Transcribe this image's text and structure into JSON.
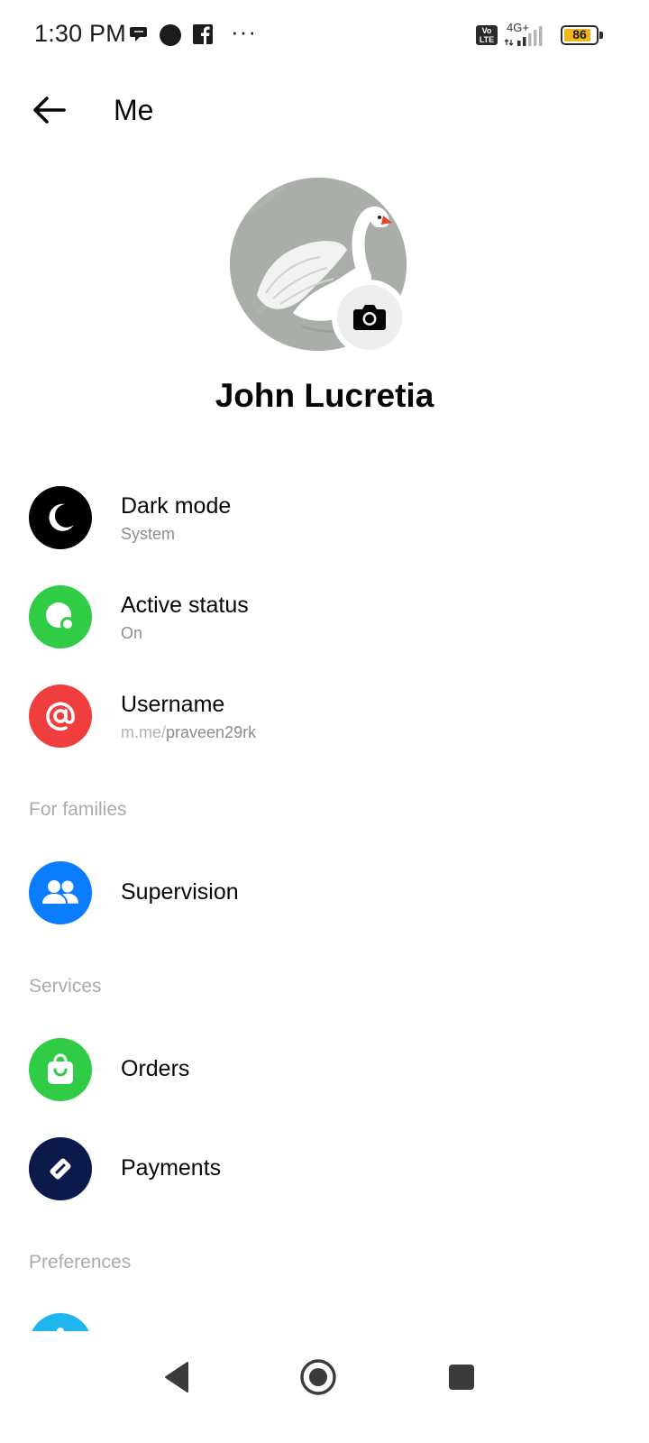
{
  "status_bar": {
    "time": "1:30 PM",
    "network_type": "4G+",
    "volte_label": "Vo LTE",
    "battery_percent": 86,
    "battery_label": "86",
    "more_indicator": "···",
    "notification_icons": [
      "chat-bubble-icon",
      "dot-icon",
      "facebook-icon"
    ]
  },
  "header": {
    "title": "Me"
  },
  "profile": {
    "name": "John Lucretia",
    "avatar_icon": "swan-photo",
    "camera_icon": "camera-icon"
  },
  "settings": {
    "dark_mode": {
      "title": "Dark mode",
      "subtitle": "System",
      "icon": "moon-icon",
      "color": "#000000"
    },
    "active_status": {
      "title": "Active status",
      "subtitle": "On",
      "icon": "active-status-icon",
      "color": "#31cc46"
    },
    "username": {
      "title": "Username",
      "subtitle_prefix": "m.me/",
      "subtitle_value": "praveen29rk",
      "icon": "at-icon",
      "color": "#f03d3d"
    }
  },
  "for_families": {
    "header": "For families",
    "supervision": {
      "title": "Supervision",
      "icon": "people-icon",
      "color": "#0a7cff"
    }
  },
  "services": {
    "header": "Services",
    "orders": {
      "title": "Orders",
      "icon": "shopping-bag-icon",
      "color": "#31cc46"
    },
    "payments": {
      "title": "Payments",
      "icon": "payment-tag-icon",
      "color": "#0b1a4a"
    }
  },
  "preferences": {
    "header": "Preferences",
    "partial_item_color": "#1fb6f0"
  },
  "nav": {
    "back": "back-triangle-icon",
    "home": "home-circle-icon",
    "recents": "recents-square-icon"
  }
}
